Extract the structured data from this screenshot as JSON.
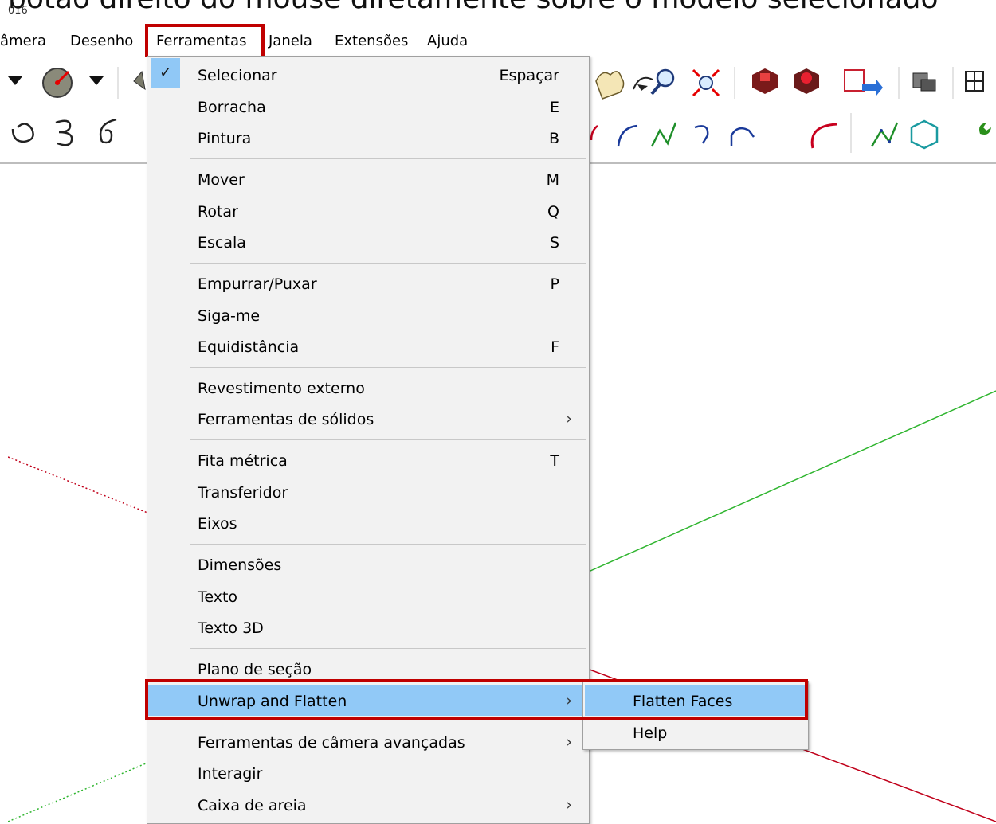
{
  "caption": "botão direito do mouse diretamente sobre o modelo selecionado",
  "version_fragment": "016",
  "menubar": {
    "items": [
      "âmera",
      "Desenho",
      "Ferramentas",
      "Janela",
      "Extensões",
      "Ajuda"
    ]
  },
  "tools_menu": {
    "items": [
      {
        "label": "Selecionar",
        "shortcut": "Espaçar",
        "checked": true
      },
      {
        "label": "Borracha",
        "shortcut": "E"
      },
      {
        "label": "Pintura",
        "shortcut": "B"
      },
      {
        "label": "Mover",
        "shortcut": "M"
      },
      {
        "label": "Rotar",
        "shortcut": "Q"
      },
      {
        "label": "Escala",
        "shortcut": "S"
      },
      {
        "label": "Empurrar/Puxar",
        "shortcut": "P"
      },
      {
        "label": "Siga-me",
        "shortcut": ""
      },
      {
        "label": "Equidistância",
        "shortcut": "F"
      },
      {
        "label": "Revestimento externo",
        "shortcut": ""
      },
      {
        "label": "Ferramentas de sólidos",
        "submenu": true
      },
      {
        "label": "Fita métrica",
        "shortcut": "T"
      },
      {
        "label": "Transferidor",
        "shortcut": ""
      },
      {
        "label": "Eixos",
        "shortcut": ""
      },
      {
        "label": "Dimensões",
        "shortcut": ""
      },
      {
        "label": "Texto",
        "shortcut": ""
      },
      {
        "label": "Texto 3D",
        "shortcut": ""
      },
      {
        "label": "Plano de seção",
        "shortcut": ""
      },
      {
        "label": "Unwrap and Flatten",
        "submenu": true,
        "highlighted": true
      },
      {
        "label": "Ferramentas de câmera avançadas",
        "submenu": true
      },
      {
        "label": "Interagir",
        "shortcut": ""
      },
      {
        "label": "Caixa de areia",
        "submenu": true
      }
    ],
    "arrow_glyph": "›",
    "check_glyph": "✓"
  },
  "submenu": {
    "items": [
      {
        "label": "Flatten Faces",
        "highlighted": true
      },
      {
        "label": "Help"
      }
    ]
  },
  "colors": {
    "highlight": "#91c9f7",
    "callout_border": "#c00000",
    "green_axis": "#2fb52f",
    "red_axis": "#c0001a",
    "arc_red": "#c8001e",
    "line_green": "#1f8f2a"
  },
  "toolbar_icons": [
    "dropdown-arrow-icon",
    "protractor-icon",
    "dropdown-arrow-icon",
    "pan-hand-icon",
    "zoom-icon",
    "zoom-extents-icon",
    "warehouse-icon",
    "extension-warehouse-icon",
    "share-model-icon",
    "component-icon",
    "section-icon",
    "spiral-icon",
    "helix-icon",
    "curve-icon",
    "arc-icon",
    "polyline-icon",
    "arc-segment-icon",
    "polygon-icon",
    "wrench-icon"
  ]
}
